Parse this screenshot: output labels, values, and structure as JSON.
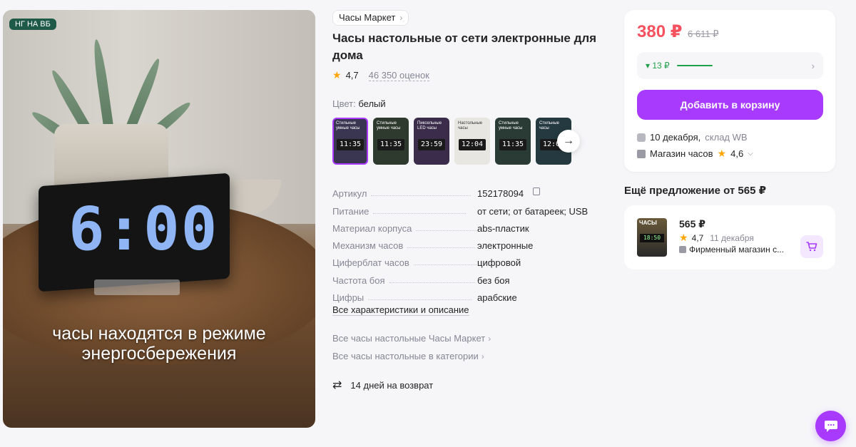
{
  "photo": {
    "badge": "НГ НА ВБ",
    "clock_time": "6:00",
    "caption_line1": "часы находятся в режиме",
    "caption_line2": "энергосбережения"
  },
  "product": {
    "brand": "Часы Маркет",
    "title": "Часы настольные от сети электронные для дома",
    "rating": "4,7",
    "reviews": "46 350 оценок",
    "color_label": "Цвет:",
    "color_value": "белый",
    "thumbnails": [
      {
        "label": "Стильные умные часы",
        "time": "11:35",
        "bg": "#3a3550"
      },
      {
        "label": "Стильные умные часы",
        "time": "11:35",
        "bg": "#2f3a2f"
      },
      {
        "label": "Пиксельные LED часы",
        "time": "23:59",
        "bg": "#3a2c4a"
      },
      {
        "label": "Настольные часы",
        "time": "12:04",
        "bg": "#e8e6e1"
      },
      {
        "label": "Стильные умные часы",
        "time": "11:35",
        "bg": "#2a3a34"
      },
      {
        "label": "Стильные часы",
        "time": "12:04",
        "bg": "#253a40"
      }
    ],
    "specs": [
      {
        "key": "Артикул",
        "value": "152178094"
      },
      {
        "key": "Питание",
        "value": "от сети; от батареек; USB"
      },
      {
        "key": "Материал корпуса",
        "value": "abs-пластик"
      },
      {
        "key": "Механизм часов",
        "value": "электронные"
      },
      {
        "key": "Циферблат часов",
        "value": "цифровой"
      },
      {
        "key": "Частота боя",
        "value": "без боя"
      },
      {
        "key": "Цифры",
        "value": "арабские"
      }
    ],
    "all_chars": "Все характеристики и описание",
    "link_brand": "Все часы настольные Часы Маркет",
    "link_category": "Все часы настольные в категории",
    "return_text": "14 дней на возврат"
  },
  "buybox": {
    "price": "380 ₽",
    "old_price": "6 611 ₽",
    "price_drop": "▾ 13 ₽",
    "cart_button": "Добавить в корзину",
    "delivery_date": "10 декабря,",
    "delivery_warehouse": "склад WB",
    "shop_name": "Магазин часов",
    "shop_rating": "4,6"
  },
  "other_offer": {
    "heading": "Ещё предложение от 565 ₽",
    "price": "565 ₽",
    "rating": "4,7",
    "date": "11 декабря",
    "shop": "Фирменный магазин с...",
    "thumb_label": "ЧАСЫ",
    "thumb_time": "18:50"
  },
  "colors": {
    "accent": "#a73afd",
    "price": "#f5515f",
    "green": "#21a04a"
  }
}
